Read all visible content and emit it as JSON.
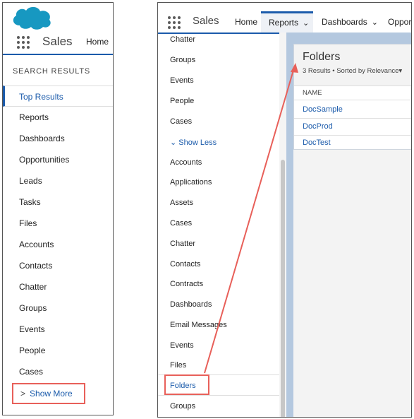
{
  "left_panel": {
    "app_name": "Sales",
    "nav_home": "Home",
    "section_title": "SEARCH RESULTS",
    "items": [
      "Top Results",
      "Reports",
      "Dashboards",
      "Opportunities",
      "Leads",
      "Tasks",
      "Files",
      "Accounts",
      "Contacts",
      "Chatter",
      "Groups",
      "Events",
      "People",
      "Cases"
    ],
    "show_more": "Show More"
  },
  "right_panel": {
    "app_name": "Sales",
    "nav": [
      "Home",
      "Reports",
      "Dashboards",
      "Opport"
    ],
    "sidebar_items_top": [
      "Chatter",
      "Groups",
      "Events",
      "People",
      "Cases"
    ],
    "show_less": "Show Less",
    "sidebar_items_bottom": [
      "Accounts",
      "Applications",
      "Assets",
      "Cases",
      "Chatter",
      "Contacts",
      "Contracts",
      "Dashboards",
      "Email Messages",
      "Events",
      "Files",
      "Folders",
      "Groups"
    ],
    "folders": {
      "title": "Folders",
      "subtitle": "3 Results • Sorted by Relevance",
      "column": "NAME",
      "rows": [
        "DocSample",
        "DocProd",
        "DocTest"
      ]
    }
  },
  "colors": {
    "brand_blue": "#1b5bab",
    "highlight_red": "#e8605a",
    "salesforce_cloud": "#1798c1"
  }
}
